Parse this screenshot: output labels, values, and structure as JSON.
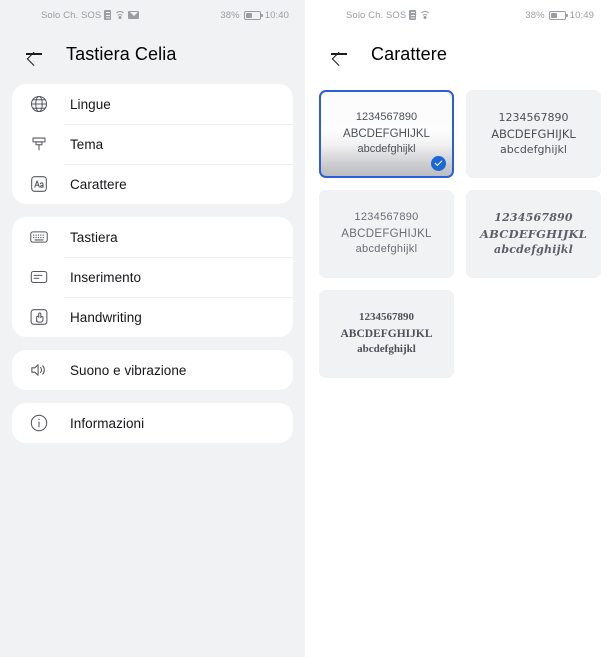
{
  "screens": [
    {
      "name": "keyboard-settings",
      "statusbar": {
        "carrier": "Solo Ch. SOS",
        "battery": "38%",
        "time": "10:40",
        "icons": [
          "sim-icon",
          "wifi-icon",
          "mail-icon",
          "battery-icon"
        ]
      },
      "title": "Tastiera Celia",
      "back_label": "back-arrow",
      "groups": [
        {
          "items": [
            {
              "label": "Lingue",
              "icon": "globe-icon"
            },
            {
              "label": "Tema",
              "icon": "paint-brush-icon"
            },
            {
              "label": "Carattere",
              "icon": "font-aa-icon"
            }
          ]
        },
        {
          "items": [
            {
              "label": "Tastiera",
              "icon": "keyboard-icon"
            },
            {
              "label": "Inserimento",
              "icon": "input-card-icon"
            },
            {
              "label": "Handwriting",
              "icon": "handwriting-hand-icon"
            }
          ]
        },
        {
          "items": [
            {
              "label": "Suono e vibrazione",
              "icon": "speaker-icon"
            }
          ]
        },
        {
          "items": [
            {
              "label": "Informazioni",
              "icon": "info-icon"
            }
          ]
        }
      ]
    },
    {
      "name": "font-picker",
      "statusbar": {
        "carrier": "Solo Ch. SOS",
        "battery": "38%",
        "time": "10:49",
        "icons": [
          "sim-icon",
          "wifi-icon",
          "battery-icon"
        ]
      },
      "title": "Carattere",
      "back_label": "back-arrow",
      "fonts": [
        {
          "digits": "1234567890",
          "upper": "ABCDEFGHIJKL",
          "lower": "abcdefghijkl",
          "selected": true,
          "style": "default-sans"
        },
        {
          "digits": "1234567890",
          "upper": "ABCDEFGHIJKL",
          "lower": "abcdefghijkl",
          "selected": false,
          "style": "neutral-sans"
        },
        {
          "digits": "1234567890",
          "upper": "ABCDEFGHIJKL",
          "lower": "abcdefghijkl",
          "selected": false,
          "style": "light-rounded"
        },
        {
          "digits": "1234567890",
          "upper": "ABCDEFGHIJKL",
          "lower": "abcdefghijkl",
          "selected": false,
          "style": "decorative-script"
        },
        {
          "digits": "1234567890",
          "upper": "ABCDEFGHIJKL",
          "lower": "abcdefghijkl",
          "selected": false,
          "style": "serif"
        }
      ],
      "selected_index": 0
    }
  ],
  "colors": {
    "accent": "#1b67d6",
    "selected_border": "#2a5fd9",
    "panel_bg": "#f0f2f4",
    "card_bg": "#ffffff",
    "font_card_bg": "#f1f2f4",
    "text": "#15161a",
    "muted": "#9a9da1"
  }
}
